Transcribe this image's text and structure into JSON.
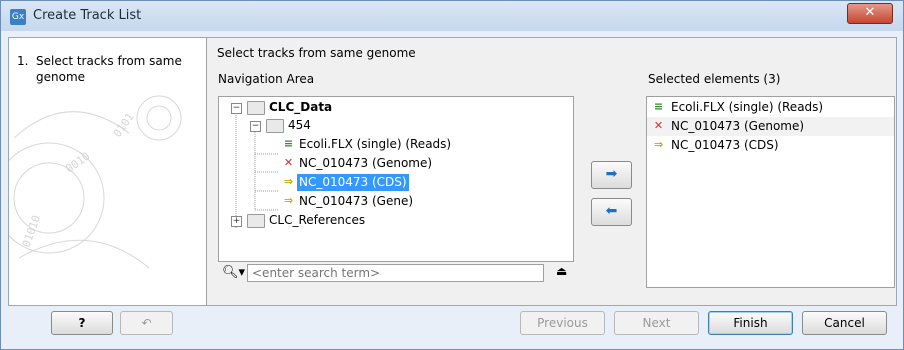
{
  "window": {
    "title": "Create Track List",
    "app_icon": "Gx",
    "close_icon": "close-icon"
  },
  "left_panel": {
    "step_number": "1.",
    "step_label": "Select tracks from same genome"
  },
  "main": {
    "heading": "Select tracks from same genome",
    "nav_label": "Navigation Area",
    "selected_label": "Selected elements (3)"
  },
  "tree": {
    "root": "CLC_Data",
    "folder": "454",
    "items": [
      {
        "label": "Ecoli.FLX (single) (Reads)",
        "icon": "reads-icon"
      },
      {
        "label": "NC_010473 (Genome)",
        "icon": "genome-icon"
      },
      {
        "label": "NC_010473 (CDS)",
        "icon": "cds-icon",
        "selected": true
      },
      {
        "label": "NC_010473 (Gene)",
        "icon": "gene-icon"
      }
    ],
    "references": "CLC_References"
  },
  "search": {
    "placeholder": "<enter search term>"
  },
  "selected_elements": [
    {
      "label": "Ecoli.FLX (single) (Reads)",
      "icon": "reads-icon"
    },
    {
      "label": "NC_010473 (Genome)",
      "icon": "genome-icon"
    },
    {
      "label": "NC_010473 (CDS)",
      "icon": "cds-icon"
    }
  ],
  "buttons": {
    "help": "?",
    "previous": "Previous",
    "next": "Next",
    "finish": "Finish",
    "cancel": "Cancel"
  },
  "colors": {
    "selection": "#3399ff",
    "titlebar": "#c6d8ee"
  }
}
